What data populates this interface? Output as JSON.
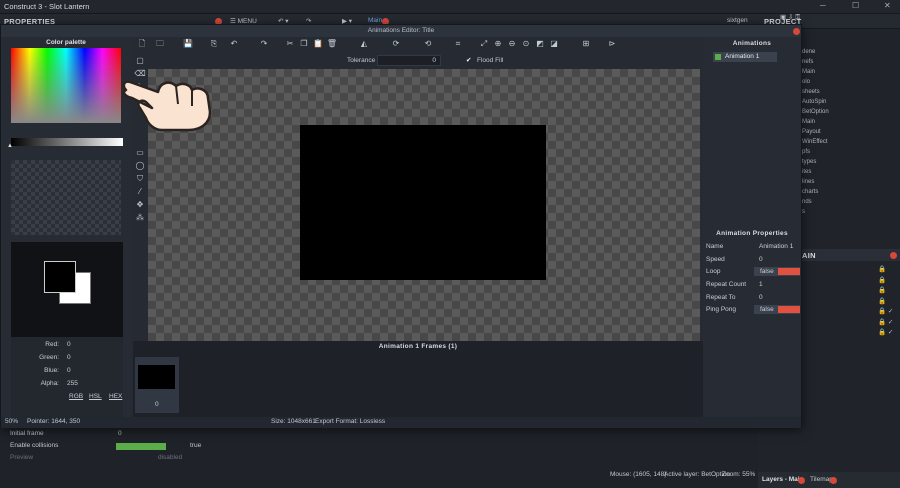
{
  "window": {
    "title": "Construct 3 - Slot Lantern"
  },
  "menubar": {
    "properties": "PROPERTIES",
    "menu": "MENU",
    "project": "PROJECT",
    "main_tab": "Main",
    "user": "sixtgen"
  },
  "editor": {
    "title": "Animations Editor: Title",
    "tolerance_label": "Tolerance",
    "tolerance_value": "0",
    "flood_fill_label": "Flood Fill",
    "flood_fill_checked": true
  },
  "palette": {
    "title": "Color palette",
    "red_label": "Red:",
    "red": "0",
    "green_label": "Green:",
    "green": "0",
    "blue_label": "Blue:",
    "blue": "0",
    "alpha_label": "Alpha:",
    "alpha": "255",
    "modes": [
      "RGB",
      "HSL",
      "HEX"
    ]
  },
  "animations": {
    "title": "Animations",
    "items": [
      "Animation 1"
    ]
  },
  "anim_props": {
    "title": "Animation Properties",
    "rows": [
      {
        "name": "Name",
        "value": "Animation 1",
        "bar": false
      },
      {
        "name": "Speed",
        "value": "0",
        "bar": false
      },
      {
        "name": "Loop",
        "value": "false",
        "bar": true
      },
      {
        "name": "Repeat Count",
        "value": "1",
        "bar": false
      },
      {
        "name": "Repeat To",
        "value": "0",
        "bar": false
      },
      {
        "name": "Ping Pong",
        "value": "false",
        "bar": true
      }
    ]
  },
  "frames": {
    "title": "Animation 1 Frames (1)",
    "items": [
      "0"
    ]
  },
  "statusbar": {
    "zoom": "50%",
    "pointer": "Pointer: 1644, 350",
    "size": "Size: 1048x661",
    "format": "Export Format: Lossless"
  },
  "bottom_props": {
    "rows": [
      {
        "name": "Initial frame",
        "value": "0"
      },
      {
        "name": "Enable collisions",
        "value": "true"
      },
      {
        "name": "Preview",
        "value": "disabled"
      }
    ]
  },
  "app_status": {
    "mouse": "Mouse: (1605, 148)",
    "layer": "Active layer: BetOption",
    "zoom": "Zoom: 55%"
  },
  "bottom_tabs": [
    "Layers - Main",
    "Tilemap"
  ],
  "right_panel": {
    "layers_title": "AIN",
    "project_items": [
      "dene",
      "nefs",
      "Main",
      "olo",
      "sheets",
      "AutoSpin",
      "BetOption",
      "Main",
      "Payout",
      "WinEffect",
      "pfs",
      "types",
      "ites",
      "lines",
      "charts",
      "nds",
      "s"
    ]
  },
  "colors": {
    "accent": "#e0523f",
    "green": "#5aad48"
  }
}
